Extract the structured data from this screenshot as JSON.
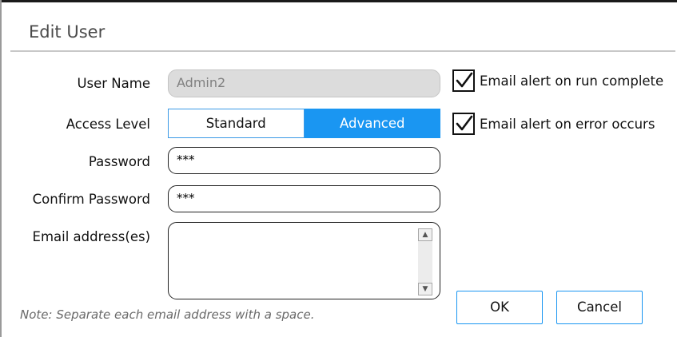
{
  "dialog": {
    "title": "Edit User",
    "note": "Note: Separate each email address with a space."
  },
  "form": {
    "user_name": {
      "label": "User Name",
      "value": "Admin2"
    },
    "access_level": {
      "label": "Access Level",
      "options": [
        "Standard",
        "Advanced"
      ],
      "selected": "Advanced"
    },
    "password": {
      "label": "Password",
      "value": "***"
    },
    "confirm_password": {
      "label": "Confirm Password",
      "value": "***"
    },
    "email_addresses": {
      "label": "Email address(es)",
      "value": ""
    }
  },
  "options": {
    "alert_run_complete": {
      "label": "Email alert on run complete",
      "checked": true
    },
    "alert_error": {
      "label": "Email alert on error occurs",
      "checked": true
    }
  },
  "buttons": {
    "ok": "OK",
    "cancel": "Cancel"
  },
  "icons": {
    "checkmark": "checkmark-icon",
    "scroll_up": "scroll-up-arrow-icon",
    "scroll_down": "scroll-down-arrow-icon"
  },
  "colors": {
    "accent": "#1a96f2",
    "title_text": "#4a4a4a",
    "note_text": "#6a6a6a"
  }
}
